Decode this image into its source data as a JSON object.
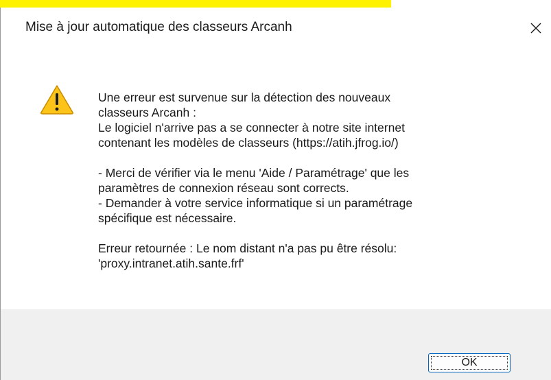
{
  "window": {
    "title": "Mise à jour automatique des classeurs Arcanh",
    "close_icon": "close-icon"
  },
  "message": {
    "icon": "warning-icon",
    "lines": [
      "Une erreur est survenue sur la détection des nouveaux",
      "classeurs Arcanh :",
      "Le logiciel n'arrive pas a se connecter à notre site internet",
      "contenant les modèles de classeurs (https://atih.jfrog.io/)",
      "",
      " - Merci de vérifier via le menu 'Aide / Paramétrage' que les",
      "paramètres de connexion réseau sont corrects.",
      " - Demander à votre service informatique si un paramétrage",
      "spécifique est nécessaire.",
      "",
      "Erreur retournée : Le nom distant n'a pas pu être résolu:",
      "'proxy.intranet.atih.sante.frf'"
    ]
  },
  "footer": {
    "ok_label": "OK"
  },
  "colors": {
    "highlight": "#fff200",
    "warning_fill": "#fcc419",
    "accent_border": "#0067c0",
    "footer_bg": "#f0f0f0"
  }
}
